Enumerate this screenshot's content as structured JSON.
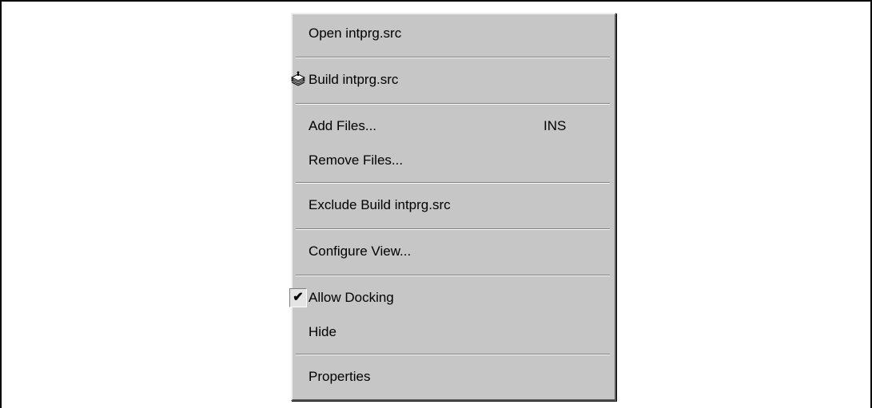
{
  "menu": {
    "open_label": "Open intprg.src",
    "build_label": "Build intprg.src",
    "add_files_label": "Add Files...",
    "add_files_shortcut": "INS",
    "remove_files_label": "Remove Files...",
    "exclude_build_label": "Exclude Build intprg.src",
    "configure_view_label": "Configure View...",
    "allow_docking_label": "Allow Docking",
    "allow_docking_checked": true,
    "hide_label": "Hide",
    "properties_label": "Properties",
    "check_glyph": "✔",
    "build_icon": "build-stack-icon"
  }
}
